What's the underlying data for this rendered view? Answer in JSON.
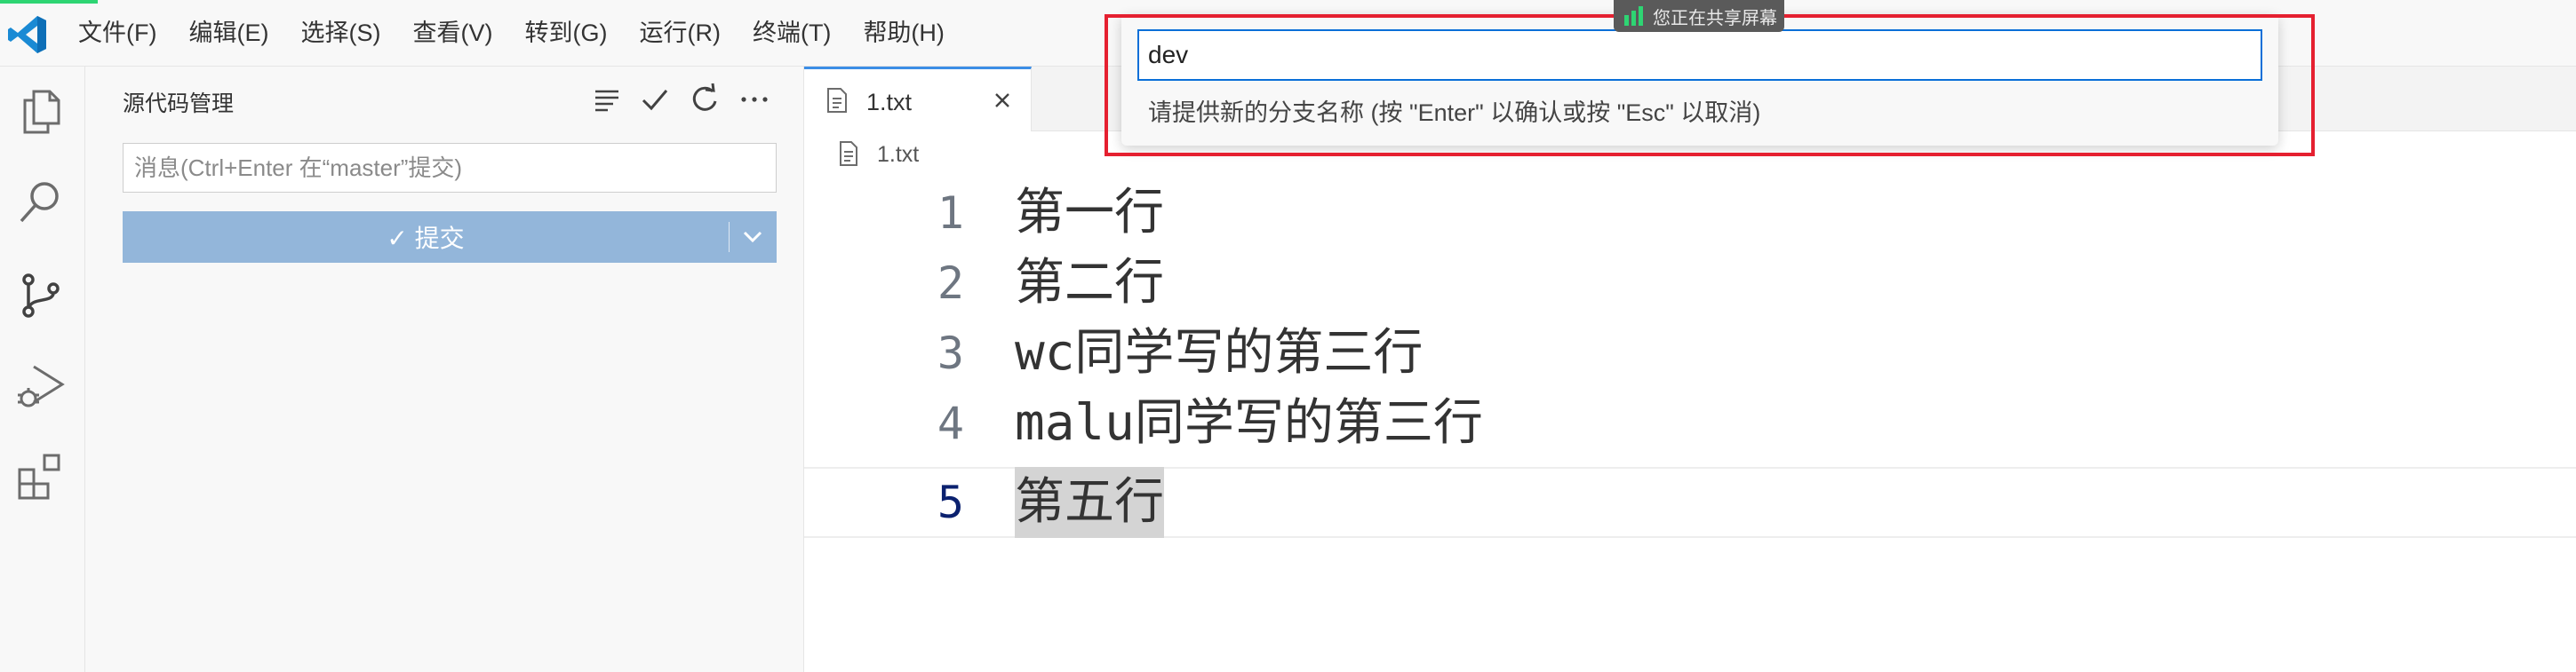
{
  "menubar": {
    "items": [
      "文件(F)",
      "编辑(E)",
      "选择(S)",
      "查看(V)",
      "转到(G)",
      "运行(R)",
      "终端(T)",
      "帮助(H)"
    ]
  },
  "activity_bar": {
    "icons": [
      "explorer-icon",
      "search-icon",
      "source-control-icon",
      "run-debug-icon",
      "extensions-icon"
    ]
  },
  "sidebar": {
    "title": "源代码管理",
    "tools": [
      "view-as-tree-icon",
      "commit-check-icon",
      "refresh-icon",
      "more-actions-icon"
    ],
    "commit_placeholder": "消息(Ctrl+Enter 在“master”提交)",
    "commit_label": "✓ 提交"
  },
  "tabs": [
    {
      "label": "1.txt",
      "active": true
    }
  ],
  "breadcrumb": {
    "file": "1.txt"
  },
  "editor": {
    "lines": [
      {
        "number": "1",
        "text": "第一行"
      },
      {
        "number": "2",
        "text": "第二行"
      },
      {
        "number": "3",
        "text": "wc同学写的第三行"
      },
      {
        "number": "4",
        "text": "malu同学写的第三行"
      },
      {
        "number": "5",
        "text": "第五行"
      }
    ],
    "current_line": 5
  },
  "quick_input": {
    "value": "dev",
    "message": "请提供新的分支名称 (按 \"Enter\" 以确认或按 \"Esc\" 以取消)"
  },
  "share_badge": {
    "text": "您正在共享屏幕"
  },
  "colors": {
    "accent": "#0a6fd8",
    "commit_button": "#93b6da",
    "annotation": "#e52030",
    "current_line_number": "#0b216f"
  }
}
